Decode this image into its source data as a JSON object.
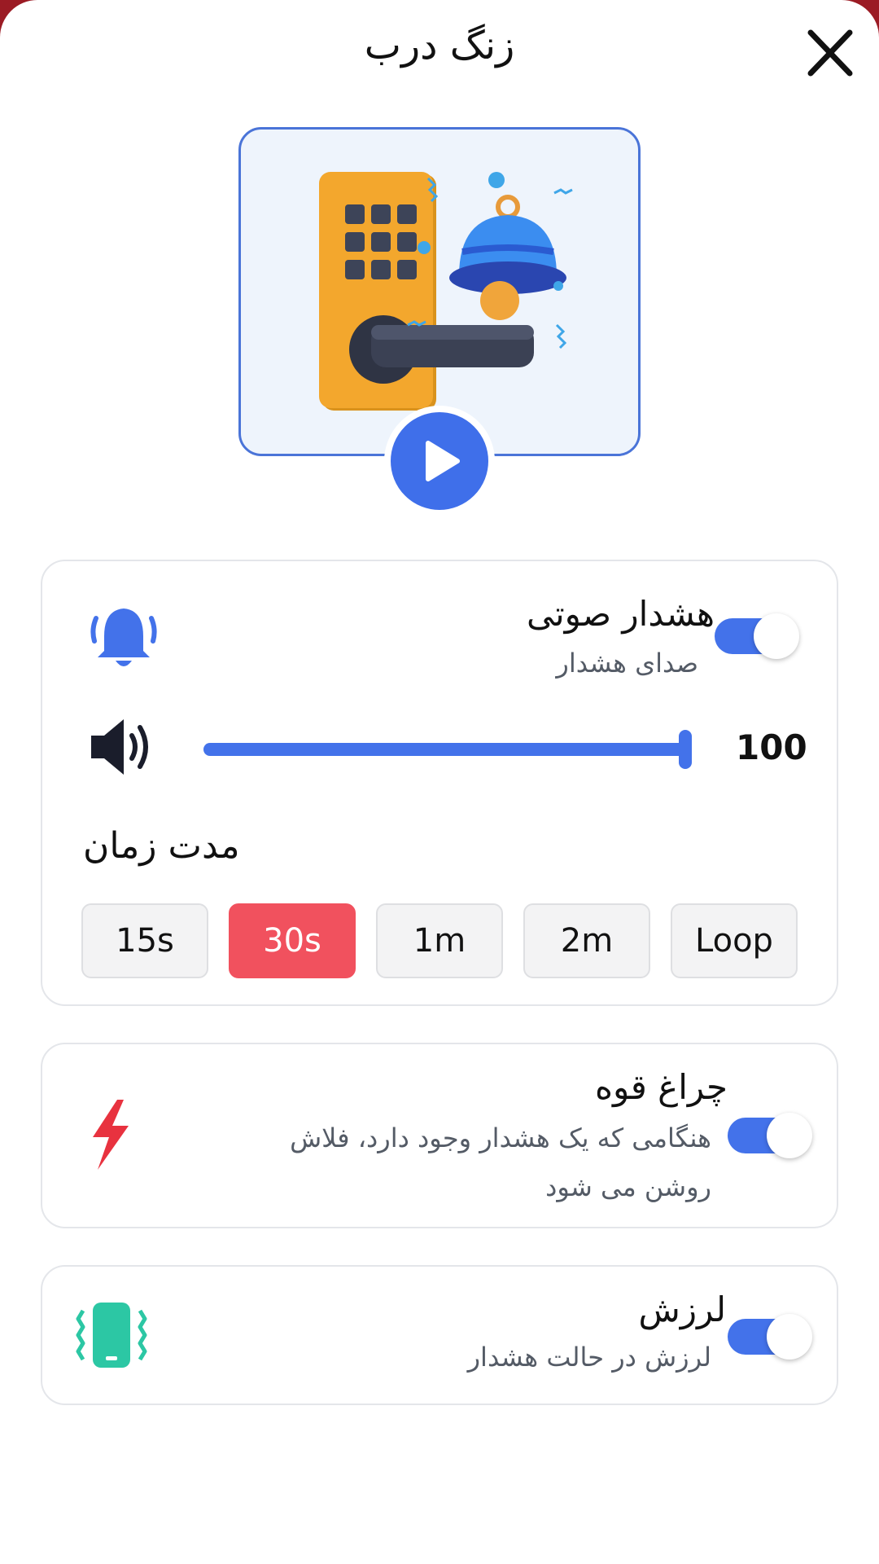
{
  "header": {
    "title": "زنگ درب"
  },
  "sound_card": {
    "title": "هشدار صوتی",
    "subtitle": "صدای هشدار",
    "enabled": true,
    "volume_value": "100",
    "volume_level": 1.0,
    "duration_label": "مدت زمان",
    "durations": [
      "15s",
      "30s",
      "1m",
      "2m",
      "Loop"
    ],
    "selected_duration": "30s"
  },
  "flash_card": {
    "title": "چراغ قوه",
    "subtitle_line1": "هنگامی که یک هشدار وجود دارد، فلاش",
    "subtitle_line2": "روشن می شود",
    "enabled": true
  },
  "vibration_card": {
    "title": "لرزش",
    "subtitle": "لرزش در حالت هشدار",
    "enabled": true
  },
  "colors": {
    "accent": "#4372ea",
    "selected": "#f1515e",
    "flash_icon": "#e8323f",
    "vibration_icon": "#2cc7a4"
  },
  "icons": [
    "close-icon",
    "play-icon",
    "bell-icon",
    "speaker-icon",
    "lightning-icon",
    "vibration-phone-icon"
  ]
}
